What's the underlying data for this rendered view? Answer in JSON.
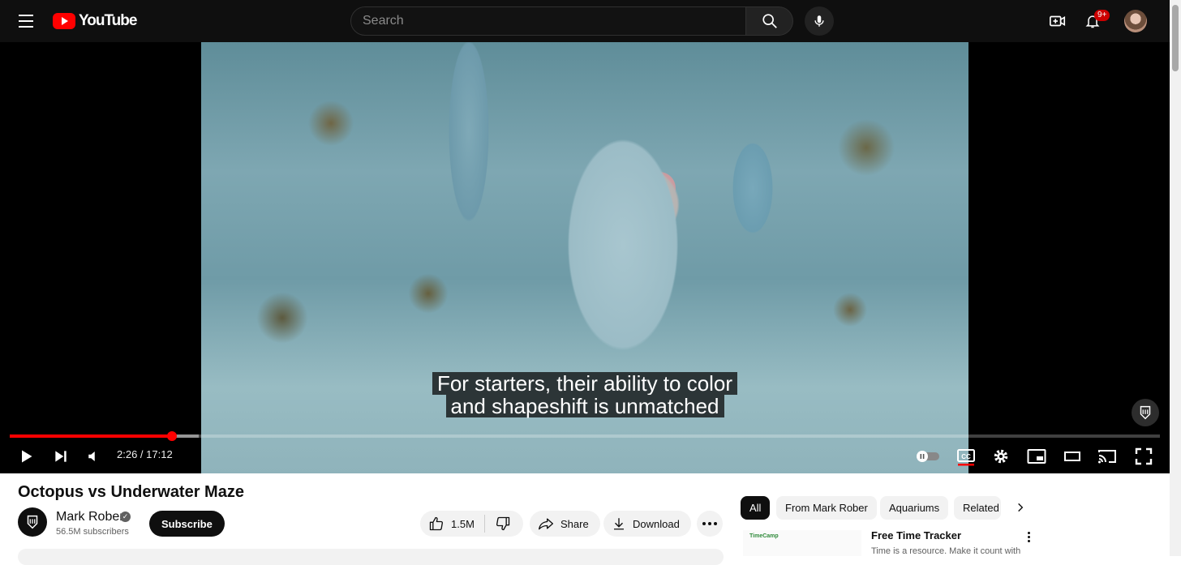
{
  "header": {
    "logo_text": "YouTube",
    "search_placeholder": "Search",
    "notifications_badge": "9+"
  },
  "player": {
    "caption_line_1": "For starters, their ability to color",
    "caption_line_2": "and shapeshift is unmatched",
    "current_time": "2:26",
    "duration": "17:12",
    "time_display": "2:26 / 17:12",
    "played_fraction": 0.141,
    "buffered_fraction": 0.164,
    "accent_color": "#ff0000"
  },
  "video": {
    "title": "Octopus vs Underwater Maze",
    "channel_name": "Mark Rober",
    "subscribers": "56.5M subscribers",
    "subscribe_label": "Subscribe",
    "like_count": "1.5M",
    "share_label": "Share",
    "download_label": "Download"
  },
  "chips": [
    "All",
    "From Mark Rober",
    "Aquariums",
    "Related"
  ],
  "sidebar_ad": {
    "brand_mark": "TimeCamp",
    "title": "Free Time Tracker",
    "description": "Time is a resource. Make it count with"
  }
}
